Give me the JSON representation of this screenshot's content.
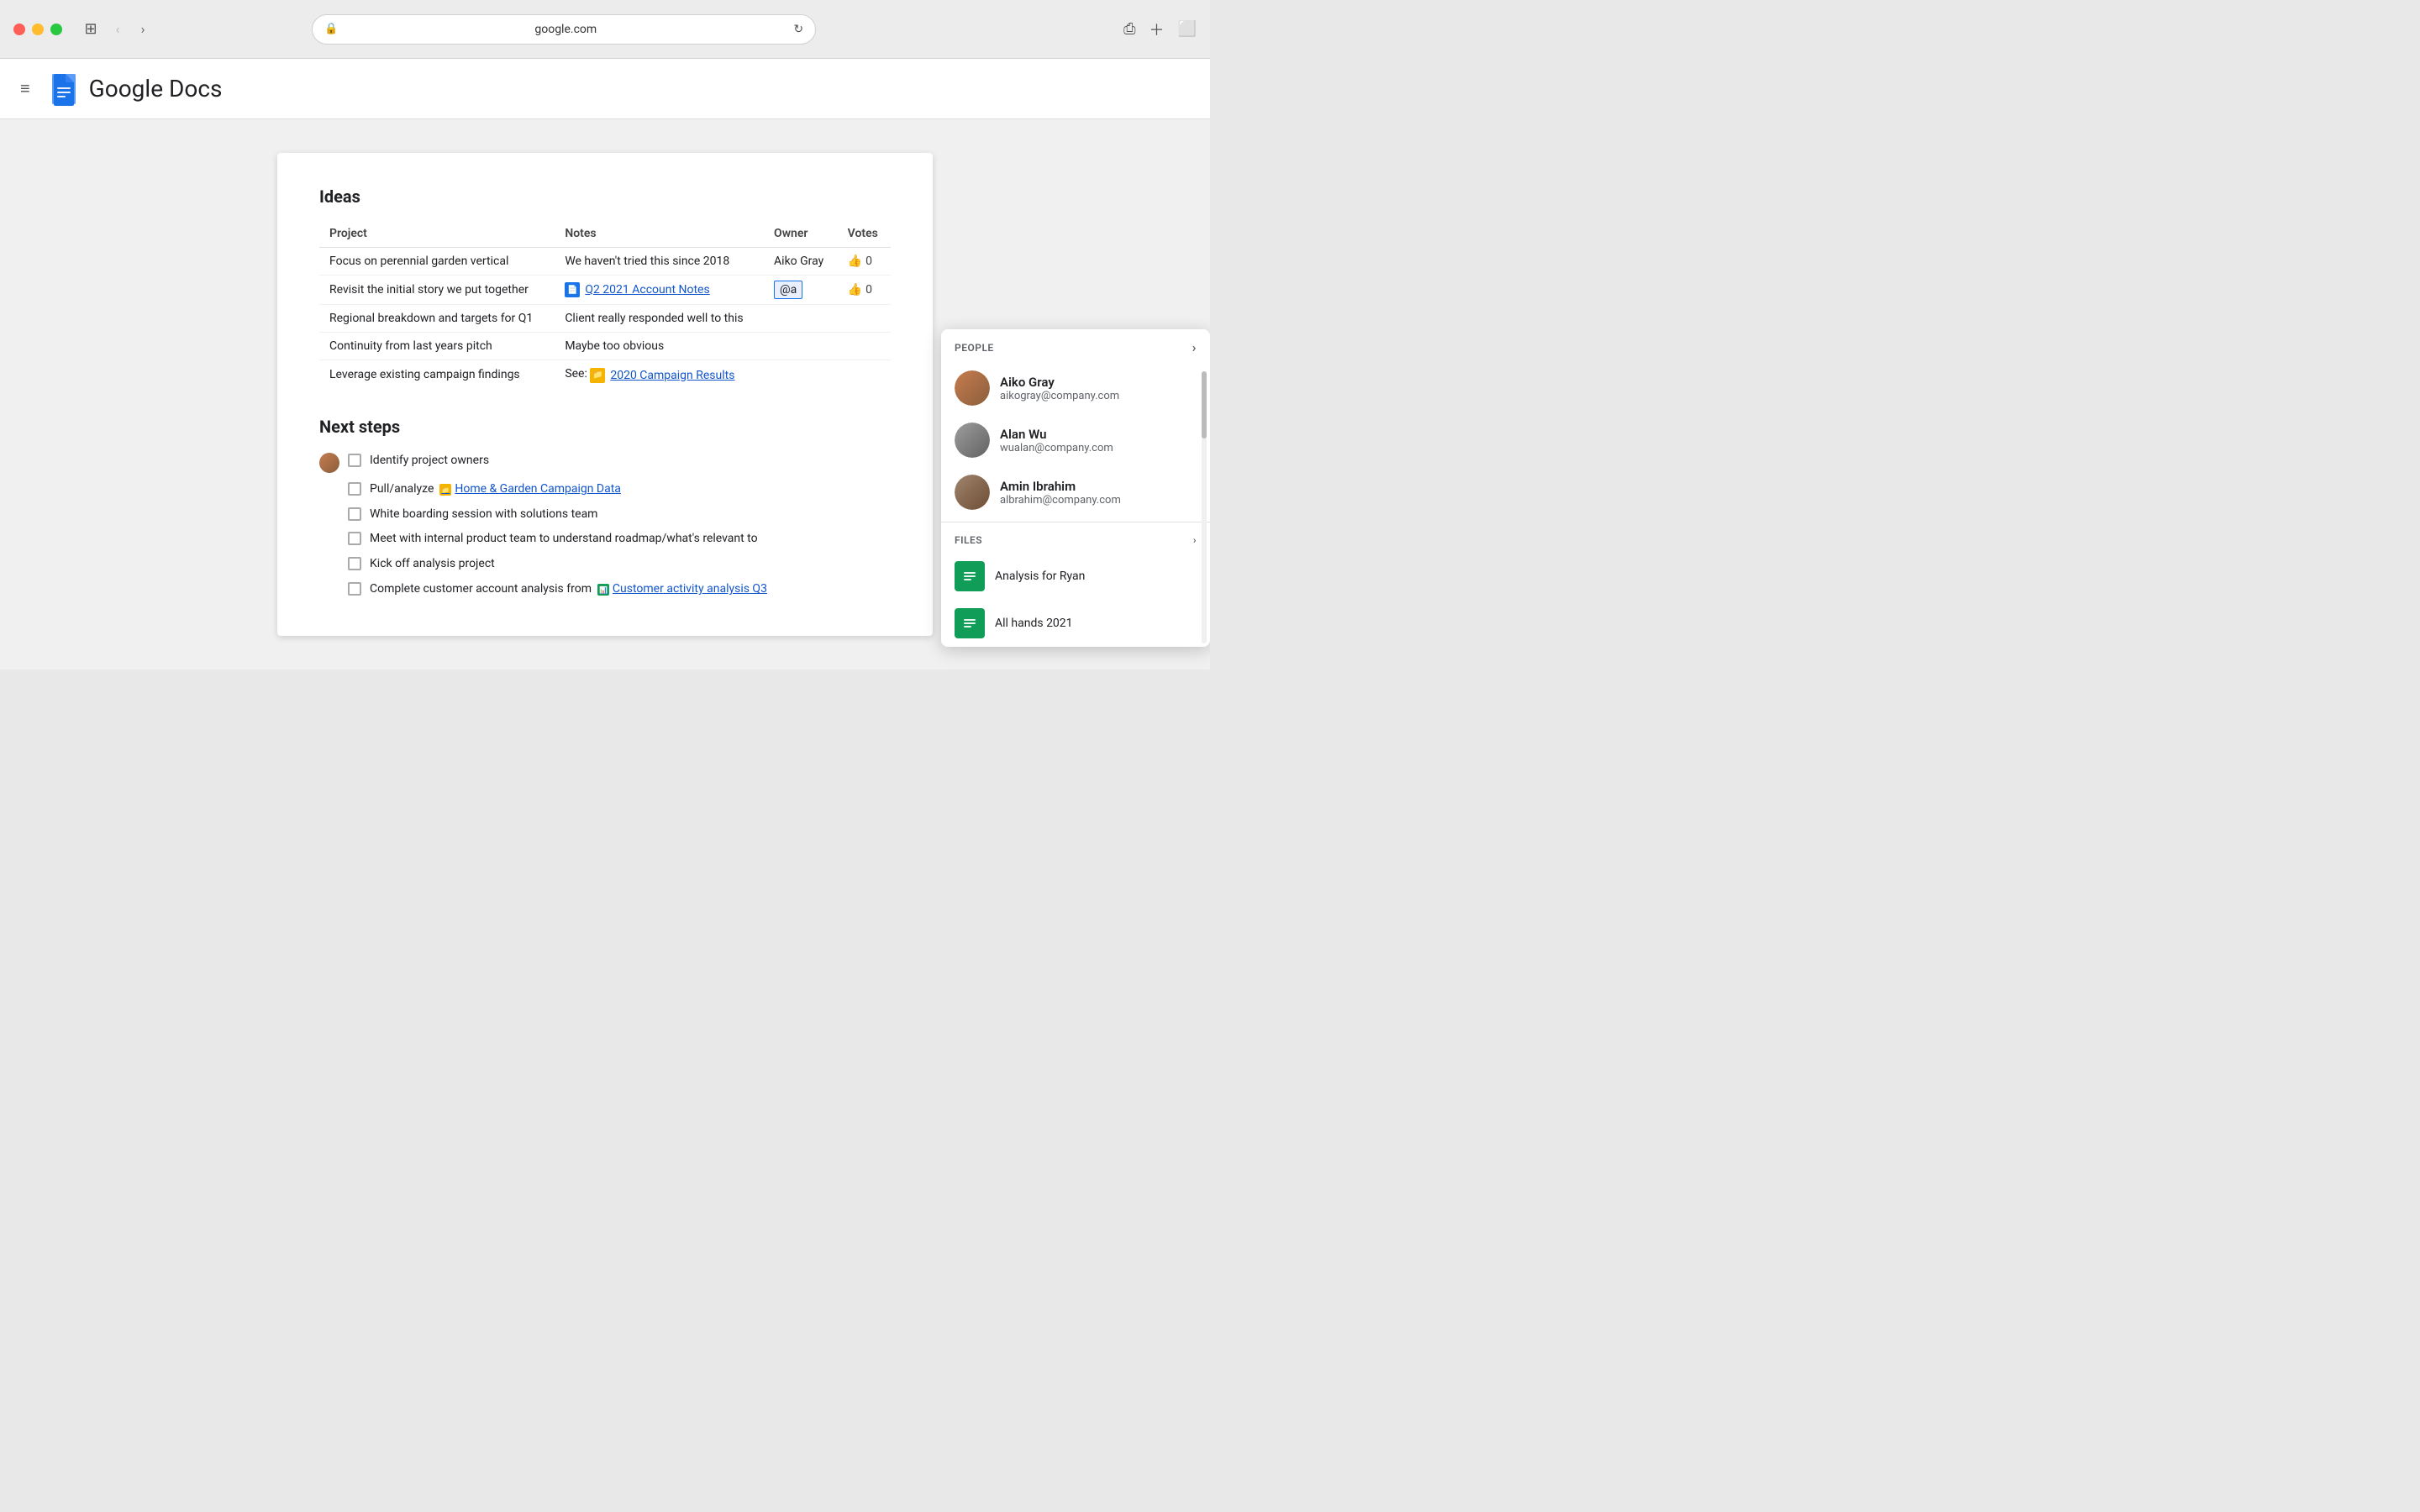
{
  "browser": {
    "url": "google.com",
    "back_btn": "‹",
    "forward_btn": "›"
  },
  "header": {
    "app_title": "Google Docs",
    "hamburger_label": "≡"
  },
  "document": {
    "ideas_section": {
      "title": "Ideas",
      "table": {
        "columns": [
          "Project",
          "Notes",
          "Owner",
          "Votes"
        ],
        "rows": [
          {
            "project": "Focus on perennial garden vertical",
            "notes_text": "We haven't tried this since 2018",
            "notes_icon": null,
            "owner": "Aiko Gray",
            "votes": "0"
          },
          {
            "project": "Revisit the initial story we put together",
            "notes_text": "Q2 2021 Account Notes",
            "notes_icon": "blue-doc",
            "owner": "@a",
            "votes": "0",
            "owner_editing": true
          },
          {
            "project": "Regional breakdown and targets for Q1",
            "notes_text": "Client really responded well to this",
            "notes_icon": null,
            "owner": "",
            "votes": ""
          },
          {
            "project": "Continuity from last years pitch",
            "notes_text": "Maybe too obvious",
            "notes_icon": null,
            "owner": "",
            "votes": ""
          },
          {
            "project": "Leverage existing campaign findings",
            "notes_text": "2020 Campaign Results",
            "notes_icon": "yellow-folder",
            "notes_prefix": "See: ",
            "owner": "",
            "votes": ""
          }
        ]
      }
    },
    "next_steps_section": {
      "title": "Next steps",
      "tasks": [
        {
          "text": "Identify project owners",
          "has_avatar": true,
          "link": null
        },
        {
          "text": "Pull/analyze ",
          "link_text": "Home & Garden Campaign Data",
          "link_type": "yellow",
          "has_avatar": false
        },
        {
          "text": "White boarding session with solutions team",
          "link": null,
          "has_avatar": false
        },
        {
          "text": "Meet with internal product team to understand roadmap/what's relevant to",
          "link": null,
          "has_avatar": false
        },
        {
          "text": "Kick off analysis project",
          "link": null,
          "has_avatar": false
        },
        {
          "text": "Complete customer account analysis from ",
          "link_text": "Customer activity analysis Q3",
          "link_type": "green",
          "has_avatar": false
        }
      ]
    }
  },
  "autocomplete": {
    "people_section_label": "PEOPLE",
    "files_section_label": "FILES",
    "people": [
      {
        "name": "Aiko Gray",
        "email": "aikogray@company.com",
        "avatar_type": "aiko"
      },
      {
        "name": "Alan Wu",
        "email": "wualan@company.com",
        "avatar_type": "alan"
      },
      {
        "name": "Amin Ibrahim",
        "email": "albrahim@company.com",
        "avatar_type": "amin"
      }
    ],
    "files": [
      {
        "name": "Analysis for Ryan",
        "icon_type": "green"
      },
      {
        "name": "All hands 2021",
        "icon_type": "green"
      }
    ]
  }
}
